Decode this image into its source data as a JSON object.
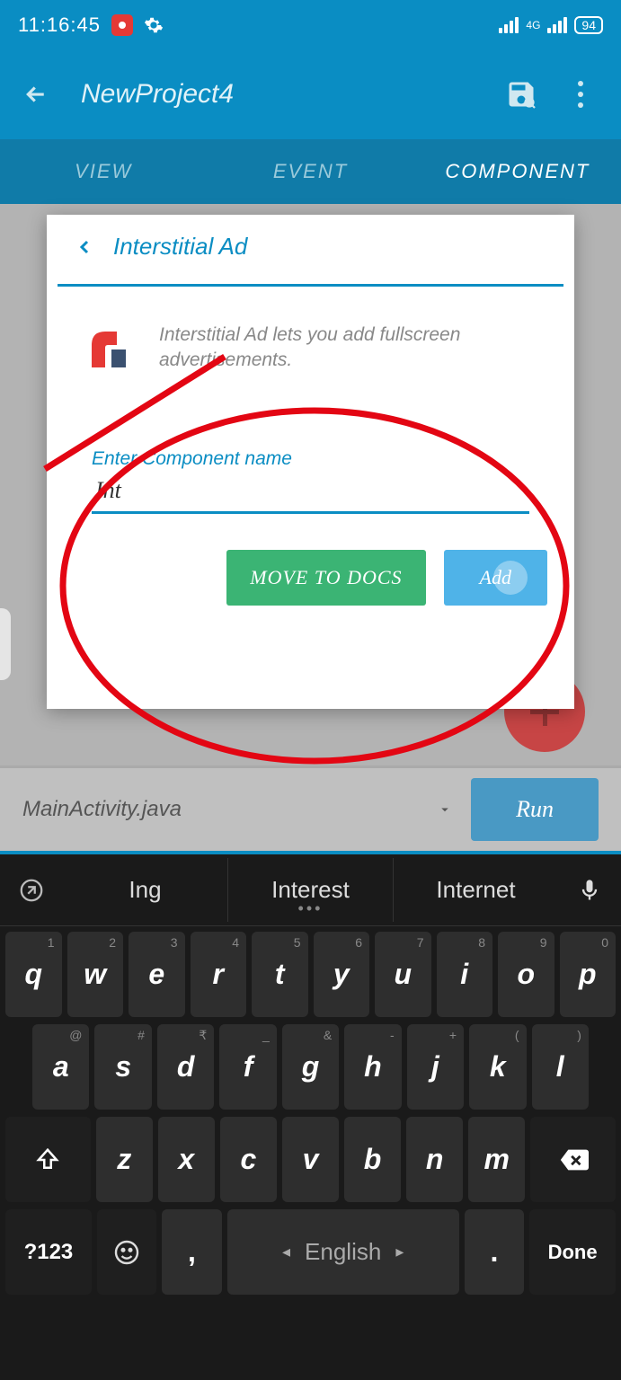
{
  "status": {
    "time": "11:16:45",
    "battery": "94",
    "network_label": "4G"
  },
  "app": {
    "title": "NewProject4"
  },
  "tabs": {
    "view": "VIEW",
    "event": "EVENT",
    "component": "COMPONENT"
  },
  "dialog": {
    "title": "Interstitial Ad",
    "description": "Interstitial Ad lets you add fullscreen advertisements.",
    "input_label": "Enter Component name",
    "input_value": "Int",
    "btn_docs": "MOVE TO DOCS",
    "btn_add": "Add"
  },
  "filebar": {
    "filename": "MainActivity.java",
    "run": "Run"
  },
  "keyboard": {
    "suggestions": [
      "Ing",
      "Interest",
      "Internet"
    ],
    "row1": [
      {
        "main": "q",
        "sup": "1"
      },
      {
        "main": "w",
        "sup": "2"
      },
      {
        "main": "e",
        "sup": "3"
      },
      {
        "main": "r",
        "sup": "4"
      },
      {
        "main": "t",
        "sup": "5"
      },
      {
        "main": "y",
        "sup": "6"
      },
      {
        "main": "u",
        "sup": "7"
      },
      {
        "main": "i",
        "sup": "8"
      },
      {
        "main": "o",
        "sup": "9"
      },
      {
        "main": "p",
        "sup": "0"
      }
    ],
    "row2": [
      {
        "main": "a",
        "sup": "@"
      },
      {
        "main": "s",
        "sup": "#"
      },
      {
        "main": "d",
        "sup": "₹"
      },
      {
        "main": "f",
        "sup": "_"
      },
      {
        "main": "g",
        "sup": "&"
      },
      {
        "main": "h",
        "sup": "-"
      },
      {
        "main": "j",
        "sup": "+"
      },
      {
        "main": "k",
        "sup": "("
      },
      {
        "main": "l",
        "sup": ")"
      }
    ],
    "row3": [
      "z",
      "x",
      "c",
      "v",
      "b",
      "n",
      "m"
    ],
    "mode": "?123",
    "comma": ",",
    "space": "English",
    "period": ".",
    "done": "Done"
  }
}
